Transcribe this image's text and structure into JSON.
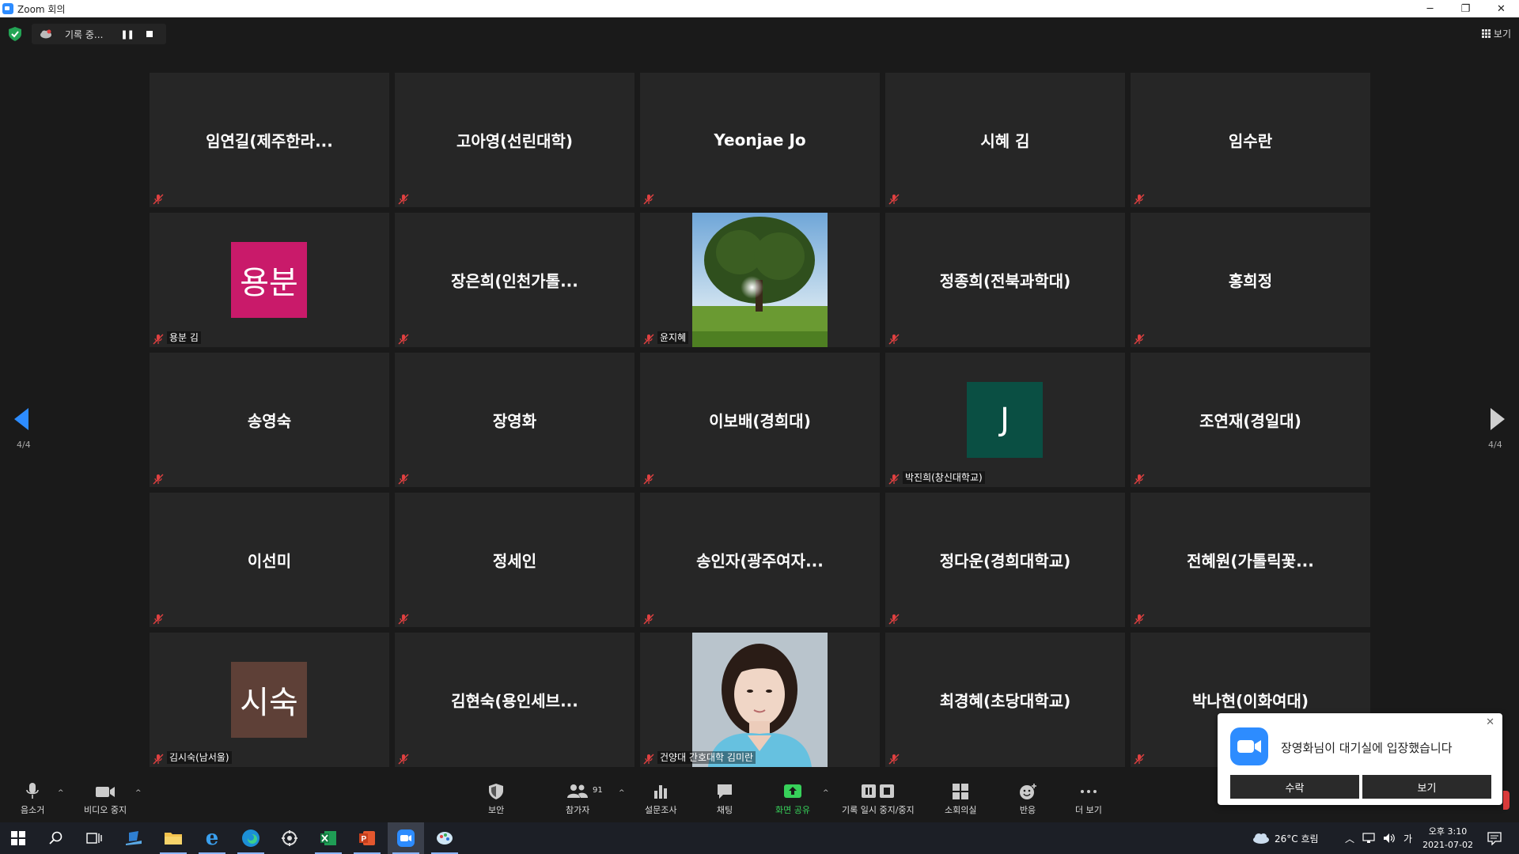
{
  "window": {
    "title": "Zoom 회의",
    "minimize": "─",
    "restore": "❐",
    "close": "✕"
  },
  "topbar": {
    "recording_text": "기록 중...",
    "pause_glyph": "❚❚",
    "view_label": "보기"
  },
  "gallery": {
    "page_left": "4/4",
    "page_right": "4/4",
    "tiles": [
      {
        "name": "임연길(제주한라...",
        "label": ""
      },
      {
        "name": "고아영(선린대학)",
        "label": ""
      },
      {
        "name": "Yeonjae Jo",
        "label": ""
      },
      {
        "name": "시혜 김",
        "label": ""
      },
      {
        "name": "임수란",
        "label": ""
      },
      {
        "name": "",
        "label": "용분 김",
        "avatar_text": "용분",
        "avatar_color": "#c91a6a"
      },
      {
        "name": "장은희(인천가톨...",
        "label": ""
      },
      {
        "name": "",
        "label": "윤지혜",
        "photo": "tree-photo"
      },
      {
        "name": "정종희(전북과학대)",
        "label": ""
      },
      {
        "name": "홍희정",
        "label": ""
      },
      {
        "name": "송영숙",
        "label": ""
      },
      {
        "name": "장영화",
        "label": ""
      },
      {
        "name": "이보배(경희대)",
        "label": ""
      },
      {
        "name": "",
        "label": "박진희(창신대학교)",
        "avatar_text": "J",
        "avatar_color": "#0a4f43"
      },
      {
        "name": "조연재(경일대)",
        "label": ""
      },
      {
        "name": "이선미",
        "label": ""
      },
      {
        "name": "정세인",
        "label": ""
      },
      {
        "name": "송인자(광주여자...",
        "label": ""
      },
      {
        "name": "정다운(경희대학교)",
        "label": ""
      },
      {
        "name": "전혜원(가톨릭꽃...",
        "label": ""
      },
      {
        "name": "",
        "label": "김시숙(남서울)",
        "avatar_text": "시숙",
        "avatar_color": "#5e4037"
      },
      {
        "name": "김현숙(용인세브...",
        "label": ""
      },
      {
        "name": "",
        "label": "건양대 간호대학 김미란",
        "photo": "portrait-photo"
      },
      {
        "name": "최경혜(초당대학교)",
        "label": ""
      },
      {
        "name": "박나현(이화여대)",
        "label": ""
      }
    ]
  },
  "toolbar": {
    "mute": "음소거",
    "video": "비디오 중지",
    "security": "보안",
    "participants": "참가자",
    "participants_count": "91",
    "polls": "설문조사",
    "chat": "채팅",
    "share": "화면 공유",
    "record": "기록 일시 중지/중지",
    "breakout": "소회의실",
    "reactions": "반응",
    "more": "더 보기",
    "caret": "^"
  },
  "notification": {
    "text": "장영화님이 대기실에 입장했습니다",
    "admit": "수락",
    "view": "보기",
    "close": "✕"
  },
  "taskbar": {
    "weather": "26°C 흐림",
    "ime": "가",
    "time": "오후 3:10",
    "date": "2021-07-02"
  }
}
